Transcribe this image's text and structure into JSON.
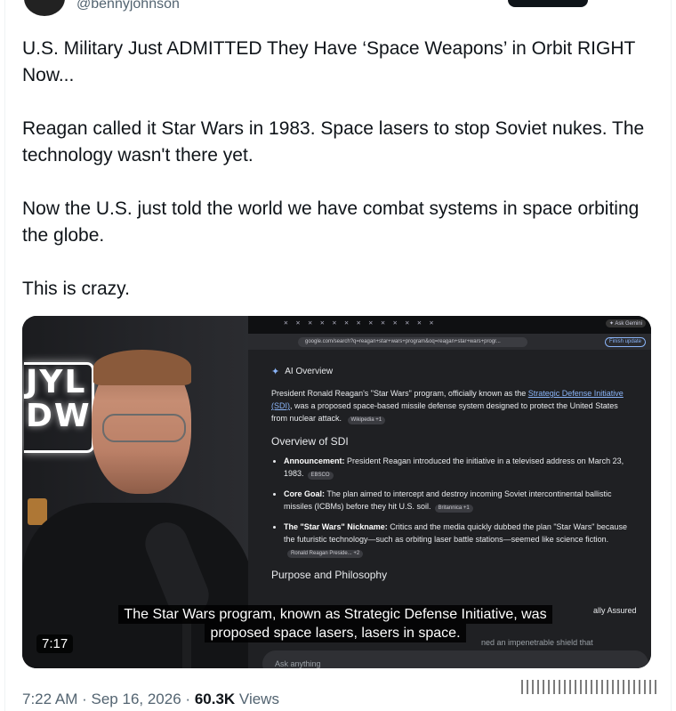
{
  "author": {
    "handle": "@bennyjohnson"
  },
  "tweet": {
    "paragraphs": [
      "U.S. Military Just ADMITTED They Have ‘Space Weapons’ in Orbit RIGHT Now...",
      "Reagan called it Star Wars in 1983. Space lasers to stop Soviet nukes. The technology wasn't there yet.",
      "Now the U.S. just told the world we have combat systems in space orbiting the globe.",
      "This is crazy."
    ]
  },
  "video": {
    "duration": "7:17",
    "studio_sign": "JYL\nDW",
    "caption_lines": [
      "The Star Wars program, known as Strategic Defense Initiative, was",
      "proposed space lasers, lasers in space."
    ],
    "browser": {
      "tabs": "✕ ✕ ✕ ✕ ✕ ✕ ✕ ✕ ✕ ✕ ✕ ✕ ✕",
      "gemini_button": "✦ Ask Gemini",
      "url": "google.com/search?q=reagan+star+wars+program&oq=reagan+star+wars+progr...",
      "update_button": "Finish update",
      "ai_overview": {
        "title": "AI Overview",
        "intro_before_link": "President Ronald Reagan's \"Star Wars\" program, officially known as the ",
        "intro_link": "Strategic Defense Initiative (SDI)",
        "intro_after_link": ", was a proposed space-based missile defense system designed to protect the United States from nuclear attack.",
        "intro_chip": "Wikipedia +1",
        "section_title": "Overview of SDI",
        "bullets": [
          {
            "label": "Announcement:",
            "text": " President Reagan introduced the initiative in a televised address on March 23, 1983.",
            "chip": "EBSCO"
          },
          {
            "label": "Core Goal:",
            "text": " The plan aimed to intercept and destroy incoming Soviet intercontinental ballistic missiles (ICBMs) before they hit U.S. soil.",
            "chip": "Britannica +1"
          },
          {
            "label": "The \"Star Wars\" Nickname:",
            "text": " Critics and the media quickly dubbed the plan \"Star Wars\" because the futuristic technology—such as orbiting laser battle stations—seemed like science fiction.",
            "chip": "Ronald Reagan Preside... +2"
          }
        ],
        "section2_title": "Purpose and Philosophy",
        "partial_right": "ally Assured",
        "partial_lower": "ned an impenetrable shield that"
      },
      "ask_placeholder": "Ask anything"
    }
  },
  "meta": {
    "time": "7:22 AM",
    "date": "Sep 16, 2026",
    "views_count": "60.3K",
    "views_label": "Views"
  }
}
